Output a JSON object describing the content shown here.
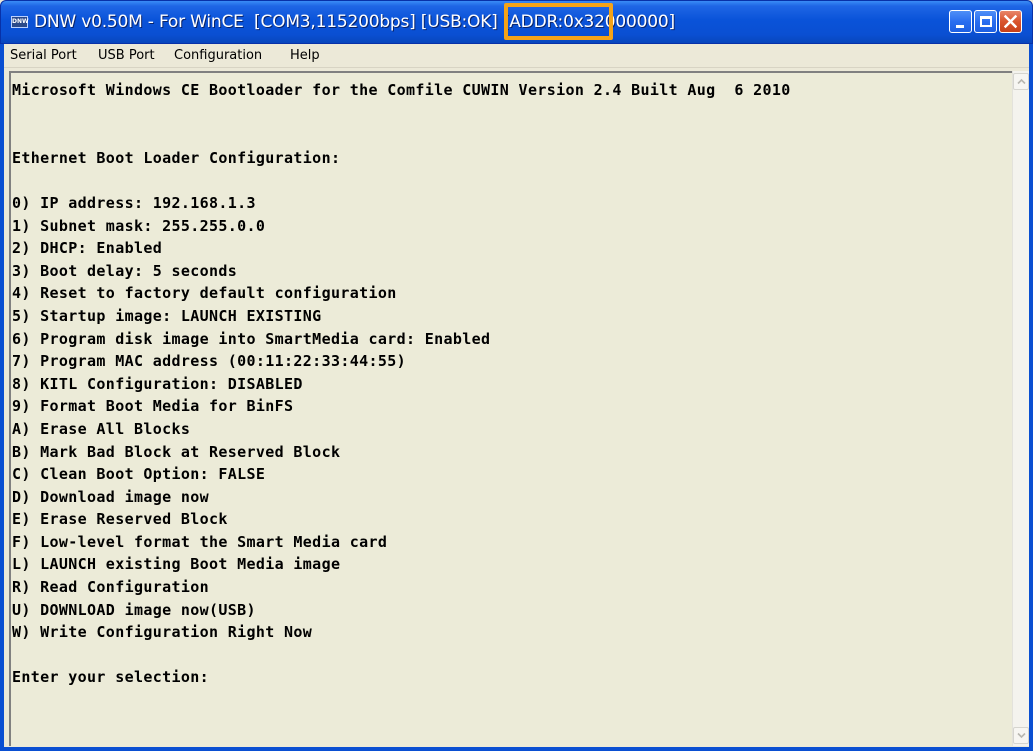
{
  "window": {
    "icon_text": "DNW",
    "title": "DNW v0.50M - For WinCE  [COM3,115200bps] [USB:OK] [ADDR:0x32000000]",
    "controls": {
      "minimize_icon": "minimize-icon",
      "maximize_icon": "maximize-icon",
      "close_icon": "close-icon"
    },
    "highlight_color": "#f5a318"
  },
  "menubar": {
    "items": [
      {
        "label": "Serial Port"
      },
      {
        "label": "USB Port"
      },
      {
        "label": "Configuration"
      },
      {
        "label": "Help"
      }
    ]
  },
  "console": {
    "lines": [
      "Microsoft Windows CE Bootloader for the Comfile CUWIN Version 2.4 Built Aug  6 2010",
      "",
      "",
      "Ethernet Boot Loader Configuration:",
      "",
      "0) IP address: 192.168.1.3",
      "1) Subnet mask: 255.255.0.0",
      "2) DHCP: Enabled",
      "3) Boot delay: 5 seconds",
      "4) Reset to factory default configuration",
      "5) Startup image: LAUNCH EXISTING",
      "6) Program disk image into SmartMedia card: Enabled",
      "7) Program MAC address (00:11:22:33:44:55)",
      "8) KITL Configuration: DISABLED",
      "9) Format Boot Media for BinFS",
      "A) Erase All Blocks",
      "B) Mark Bad Block at Reserved Block",
      "C) Clean Boot Option: FALSE",
      "D) Download image now",
      "E) Erase Reserved Block",
      "F) Low-level format the Smart Media card",
      "L) LAUNCH existing Boot Media image",
      "R) Read Configuration",
      "U) DOWNLOAD image now(USB)",
      "W) Write Configuration Right Now",
      "",
      "Enter your selection:"
    ]
  },
  "scrollbar": {
    "up_icon": "scroll-up-arrow-icon",
    "down_icon": "scroll-down-arrow-icon"
  }
}
